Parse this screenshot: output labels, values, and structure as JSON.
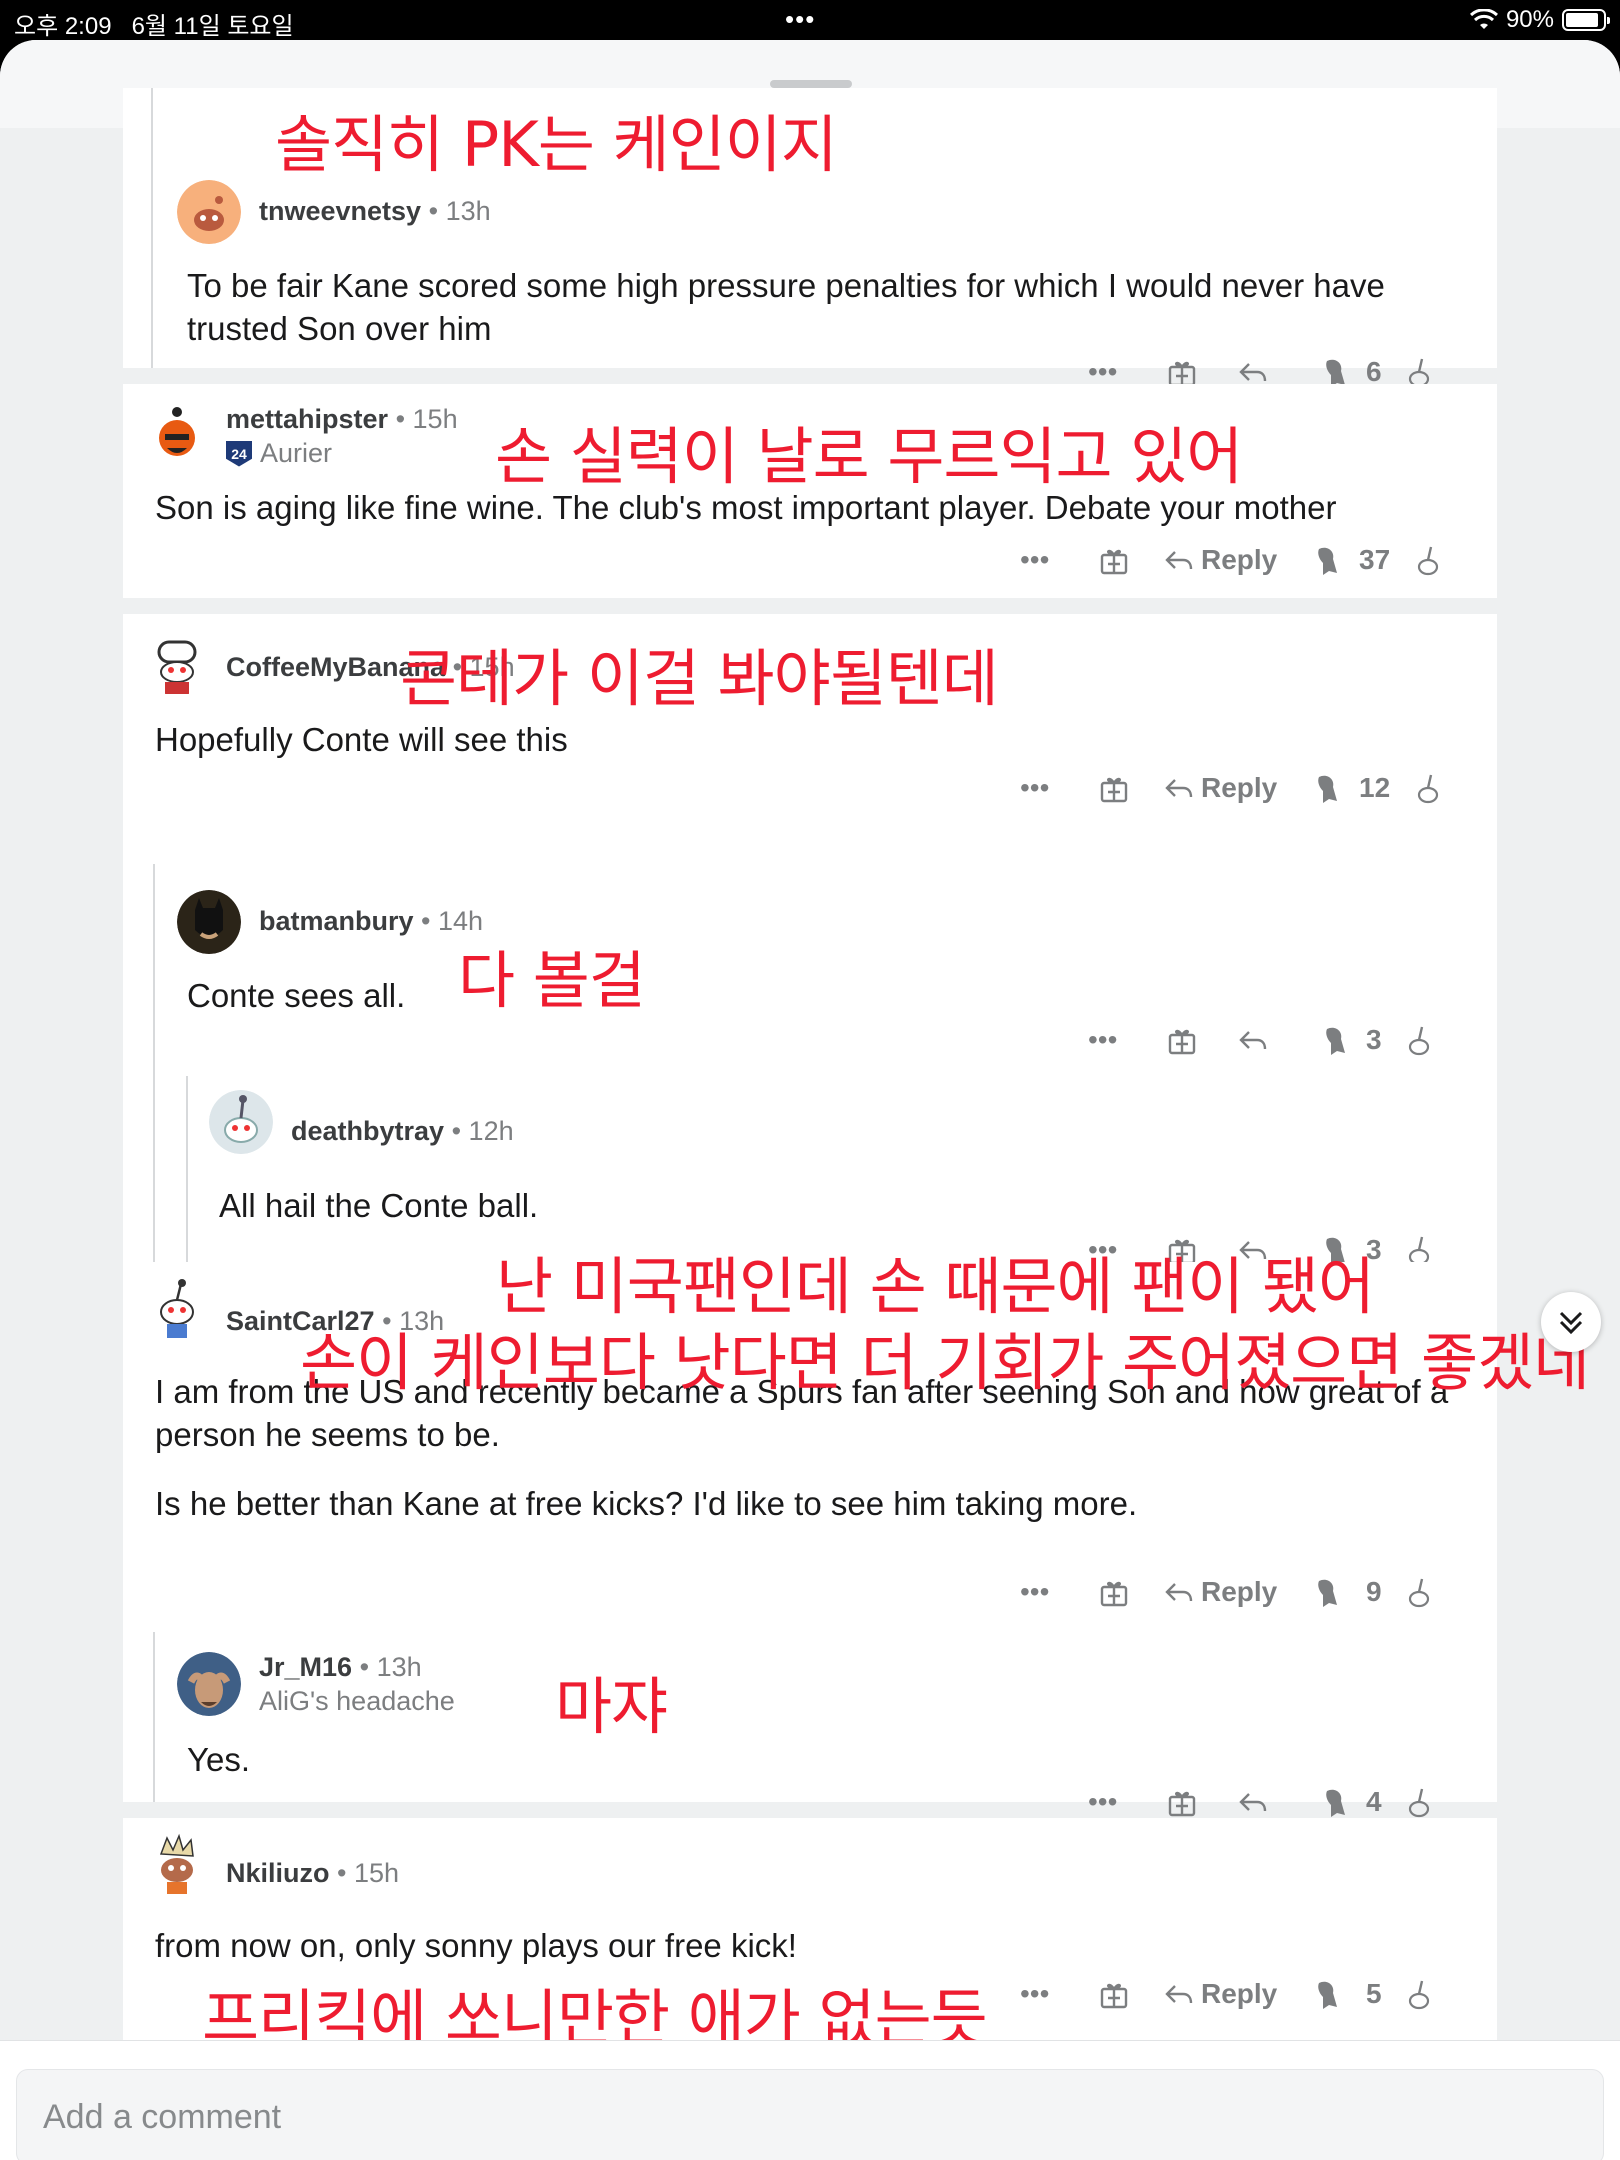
{
  "status_bar": {
    "time": "오후 2:09",
    "date": "6월 11일 토요일",
    "battery": "90%",
    "battery_level": 0.9
  },
  "labels": {
    "reply": "Reply"
  },
  "comments": [
    {
      "username": "tnweevnetsy",
      "time": "13h",
      "text": [
        "To be fair Kane scored some high pressure penalties for which I would never have trusted Son over him"
      ],
      "votes": "6"
    },
    {
      "username": "mettahipster",
      "time": "15h",
      "flair": "Aurier",
      "flair_badge": "24",
      "text": [
        "Son is aging like fine wine. The club's most important player. Debate your mother"
      ],
      "votes": "37"
    },
    {
      "username": "CoffeeMyBanana",
      "time": "15h",
      "text": [
        "Hopefully Conte will see this"
      ],
      "votes": "12"
    },
    {
      "username": "batmanbury",
      "time": "14h",
      "text": [
        "Conte sees all."
      ],
      "votes": "3"
    },
    {
      "username": "deathbytray",
      "time": "12h",
      "text": [
        "All hail the Conte ball."
      ],
      "votes": "3"
    },
    {
      "username": "SaintCarl27",
      "time": "13h",
      "text": [
        "I am from the US and recently became a Spurs fan after seening Son and how great of a person he seems to be.",
        "Is he better than Kane at free kicks? I'd like to see him taking more."
      ],
      "votes": "9"
    },
    {
      "username": "Jr_M16",
      "time": "13h",
      "flair": "AliG's headache",
      "text": [
        "Yes."
      ],
      "votes": "4"
    },
    {
      "username": "Nkiliuzo",
      "time": "15h",
      "text": [
        "from now on, only sonny plays our free kick!"
      ],
      "votes": "5"
    }
  ],
  "overlays": [
    "솔직히 PK는 케인이지",
    "손 실력이 날로 무르익고 있어",
    "콘테가 이걸 봐야될텐데",
    "다 볼걸",
    "난 미국팬인데 손 때문에 팬이 됐어",
    "손이 케인보다 낫다면 더 기회가 주어졌으면 좋겠네",
    "마쟈",
    "프리킥에 쏘니만한 애가 없는듯"
  ],
  "composer": {
    "placeholder": "Add a comment"
  },
  "colors": {
    "overlay_text": "#ee1c30",
    "meta_gray": "#7c7e80",
    "sheet_bg": "#eef0f1"
  }
}
